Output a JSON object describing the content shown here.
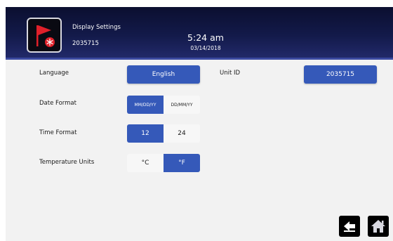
{
  "header": {
    "title": "Display Settings",
    "unit_number": "2035715",
    "time": "5:24 am",
    "date": "03/14/2018",
    "icon": "red-flag-snowflake-icon"
  },
  "settings": {
    "language": {
      "label": "Language",
      "value": "English"
    },
    "unit_id": {
      "label": "Unit ID",
      "value": "2035715"
    },
    "date_format": {
      "label": "Date Format",
      "options": [
        "MM/DD/YY",
        "DD/MM/YY"
      ],
      "selected": "MM/DD/YY"
    },
    "time_format": {
      "label": "Time Format",
      "options": [
        "12",
        "24"
      ],
      "selected": "12"
    },
    "temperature_units": {
      "label": "Temperature Units",
      "options": [
        "°C",
        "°F"
      ],
      "selected": "°F"
    }
  },
  "nav": {
    "back_icon": "back-arrow-icon",
    "home_icon": "home-icon"
  },
  "colors": {
    "header_dark": "#0b0f30",
    "accent_blue": "#3559b9",
    "flag_red": "#e0202a"
  }
}
